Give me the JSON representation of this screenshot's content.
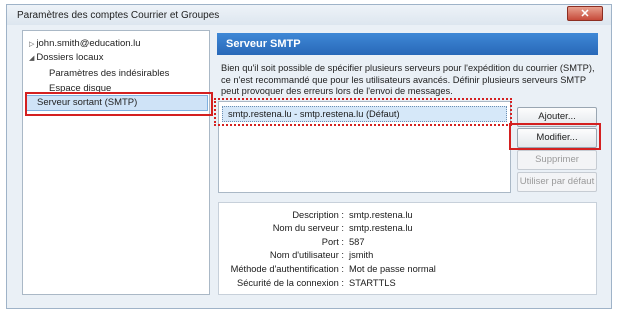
{
  "window": {
    "title": "Paramètres des comptes Courrier et Groupes",
    "close_label": "✕"
  },
  "tree": {
    "items": [
      {
        "label": "john.smith@education.lu"
      },
      {
        "label": "Dossiers locaux"
      },
      {
        "label": "Paramètres des indésirables"
      },
      {
        "label": "Espace disque"
      },
      {
        "label": "Serveur sortant (SMTP)"
      }
    ]
  },
  "panel": {
    "title": "Serveur SMTP",
    "description": "Bien qu'il soit possible de spécifier plusieurs serveurs pour l'expédition du courrier (SMTP), ce n'est recommandé que pour les utilisateurs avancés. Définir plusieurs serveurs SMTP peut provoquer des erreurs lors de l'envoi de messages."
  },
  "servers": [
    {
      "label": "smtp.restena.lu - smtp.restena.lu (Défaut)"
    }
  ],
  "buttons": {
    "add": "Ajouter...",
    "modify": "Modifier...",
    "delete": "Supprimer",
    "default": "Utiliser par défaut"
  },
  "details": [
    {
      "label": "Description :",
      "value": "smtp.restena.lu"
    },
    {
      "label": "Nom du serveur :",
      "value": "smtp.restena.lu"
    },
    {
      "label": "Port :",
      "value": "587"
    },
    {
      "label": "Nom d'utilisateur :",
      "value": "jsmith"
    },
    {
      "label": "Méthode d'authentification :",
      "value": "Mot de passe normal"
    },
    {
      "label": "Sécurité de la connexion :",
      "value": "STARTTLS"
    }
  ],
  "colors": {
    "header": "#2f78c8",
    "highlight_box": "#d42020",
    "selection": "#cfe3f7"
  }
}
